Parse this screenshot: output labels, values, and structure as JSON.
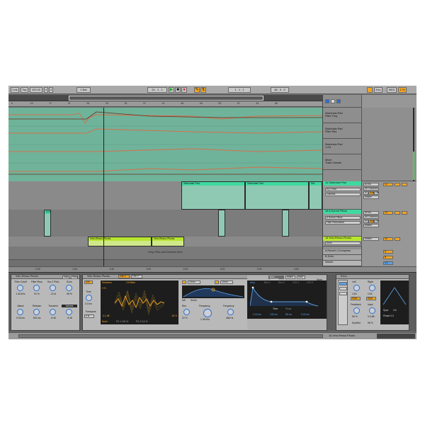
{
  "transport": {
    "link": "Link",
    "tap": "Tap",
    "tempo": "100.00",
    "sig_num": "4",
    "sig_den": "4",
    "quantize": "1 Bar",
    "position": "24 . 1 . 1",
    "loop_start": "1 . 1 . 1",
    "loop_len": "48 . 0 . 0",
    "key": "Key",
    "midi": "MIDI",
    "cpu": "2 %"
  },
  "ruler": {
    "ticks": [
      "9",
      "13",
      "17",
      "21",
      "25",
      "29",
      "33",
      "37",
      "41",
      "45",
      "49",
      "53",
      "57",
      "61",
      "65"
    ]
  },
  "time_ruler": {
    "ticks": [
      "0:30",
      "1:00",
      "1:30",
      "2:00",
      "2:30",
      "3:00",
      "3:30",
      "4:00"
    ]
  },
  "tracks": {
    "automation": [
      {
        "name": "Sidechain Pad",
        "param": "Filter Freq"
      },
      {
        "name": "Sidechain Pad",
        "param": "Filter Res"
      },
      {
        "name": "Sidechain Pad",
        "param": "1-Os"
      },
      {
        "name": "Mixer",
        "param": "Track Volume"
      }
    ],
    "track14": {
      "num": "14",
      "name": "Sidechain Pad",
      "in": "All Ins",
      "ch": "All Channels",
      "mon1": "In",
      "mon2": "Auto",
      "mon3": "Off",
      "route": "Master",
      "vol": "14",
      "sel1": "EQ Three",
      "sel2": "GainMid"
    },
    "track15": {
      "num": "15",
      "name": "A Hornet Pillow",
      "in": "All Ins",
      "ch": "All Channels",
      "mon1": "In",
      "mon2": "Auto",
      "mon3": "Off",
      "route": "Master",
      "vol": "15",
      "sel1": "A Hornet Pillow",
      "sel2": "Filter Resonance"
    },
    "track16": {
      "num": "16",
      "name": "Velo-Resso-Plucks",
      "route": "Master",
      "vol": "16",
      "sel": "None"
    },
    "drop_text": "Drop Files and Devices Here",
    "returnA": {
      "name": "A Reverb | Compress",
      "vol": "A"
    },
    "returnB": {
      "name": "B Echo",
      "vol": "B"
    },
    "master": {
      "name": "Master",
      "vol": "1/2"
    }
  },
  "clips": {
    "pad1": "Sidechain Pad",
    "pad2": "Sidechain Pad",
    "pad3": "Sid",
    "horn": "A Hor",
    "pluck1": "Velo-Resso-Plucks",
    "pluck2": "Velo-Resso-Plucks"
  },
  "devices": {
    "rack": {
      "title": "Velo-Resso-Plucks",
      "macros": [
        {
          "name": "Filter Cutoff",
          "value": "1.48 kHz"
        },
        {
          "name": "Filter Reso",
          "value": "51 %"
        },
        {
          "name": "Osc 2 Pitch",
          "value": "-12 st"
        },
        {
          "name": "Echo",
          "value": "58 %"
        },
        {
          "name": "Attack",
          "value": "0.00 ms"
        },
        {
          "name": "Release",
          "value": "153 ms"
        },
        {
          "name": "Transient",
          "value": "-9.46"
        },
        {
          "name": "Volume",
          "value": "-9.46"
        }
      ],
      "map": "Map",
      "rand": "Rand"
    },
    "wavetable": {
      "title": "Velo-Resso-Plucks",
      "tab1": "Osc 1",
      "tab2": "Osc 2",
      "tab_sub": "Sub",
      "osc_label": "Distortion",
      "osc_wave": "1/4 Bitter",
      "pos": "0 %",
      "gain_left": "-3.1 dB",
      "gain_right": "28 %",
      "none": "None",
      "fx1": "FX 1 100 %",
      "fx2": "FX 2 0.0 %",
      "time": "Time",
      "time_val": "0.0 ms",
      "transpose": "Transpose",
      "transpose_val": "0 st",
      "filter_type": "Clean",
      "filter_type2": "Clean",
      "filter_mode": "MS",
      "serial": "Serial",
      "res": "Res",
      "res_val": "22 %",
      "freq": "Frequency",
      "freq_val": "1.38 kHz",
      "freq2": "Frequency",
      "freq2_val": "486 Hz",
      "mod_tabs": [
        "Amp",
        "Env 2",
        "Env 3",
        "LFO 1",
        "LFO 2"
      ],
      "mod_matrix": "Mod Sources",
      "matrix": "Matrix",
      "midi": "MIDI",
      "env_time": "Time",
      "env_scale": "Slope",
      "env_vals": [
        "0.00 ms",
        "242 ms",
        "88 ms",
        "0.00 ms"
      ],
      "voice": "Voice",
      "unison": "None"
    },
    "echo": {
      "title": "Echo",
      "left": "Left",
      "right": "Right",
      "left_val": "1/16",
      "right_val": "1/16",
      "sync1": "Sync",
      "sync2": "Sync",
      "feedback": "Feedback",
      "feedback_val": "50 %",
      "input": "Input",
      "input_val": "0.0 dB",
      "filter": "Filter",
      "reverb": "Reverb",
      "dry_wet": "Dry/Wet",
      "dry_wet_val": "58 %",
      "sync_label": "Sync",
      "rate": "1/4",
      "phase": "Phase 0.0"
    }
  },
  "status": {
    "track_label": "16-Velo-Resso-Plucks"
  },
  "colors": {
    "teal": "#6fb39a",
    "teal_light": "#8fc9b4",
    "green": "#3fd9a0",
    "lime": "#b8e62e",
    "orange": "#f2a623",
    "automation": "#d4704c",
    "blue": "#2a6fd6"
  }
}
